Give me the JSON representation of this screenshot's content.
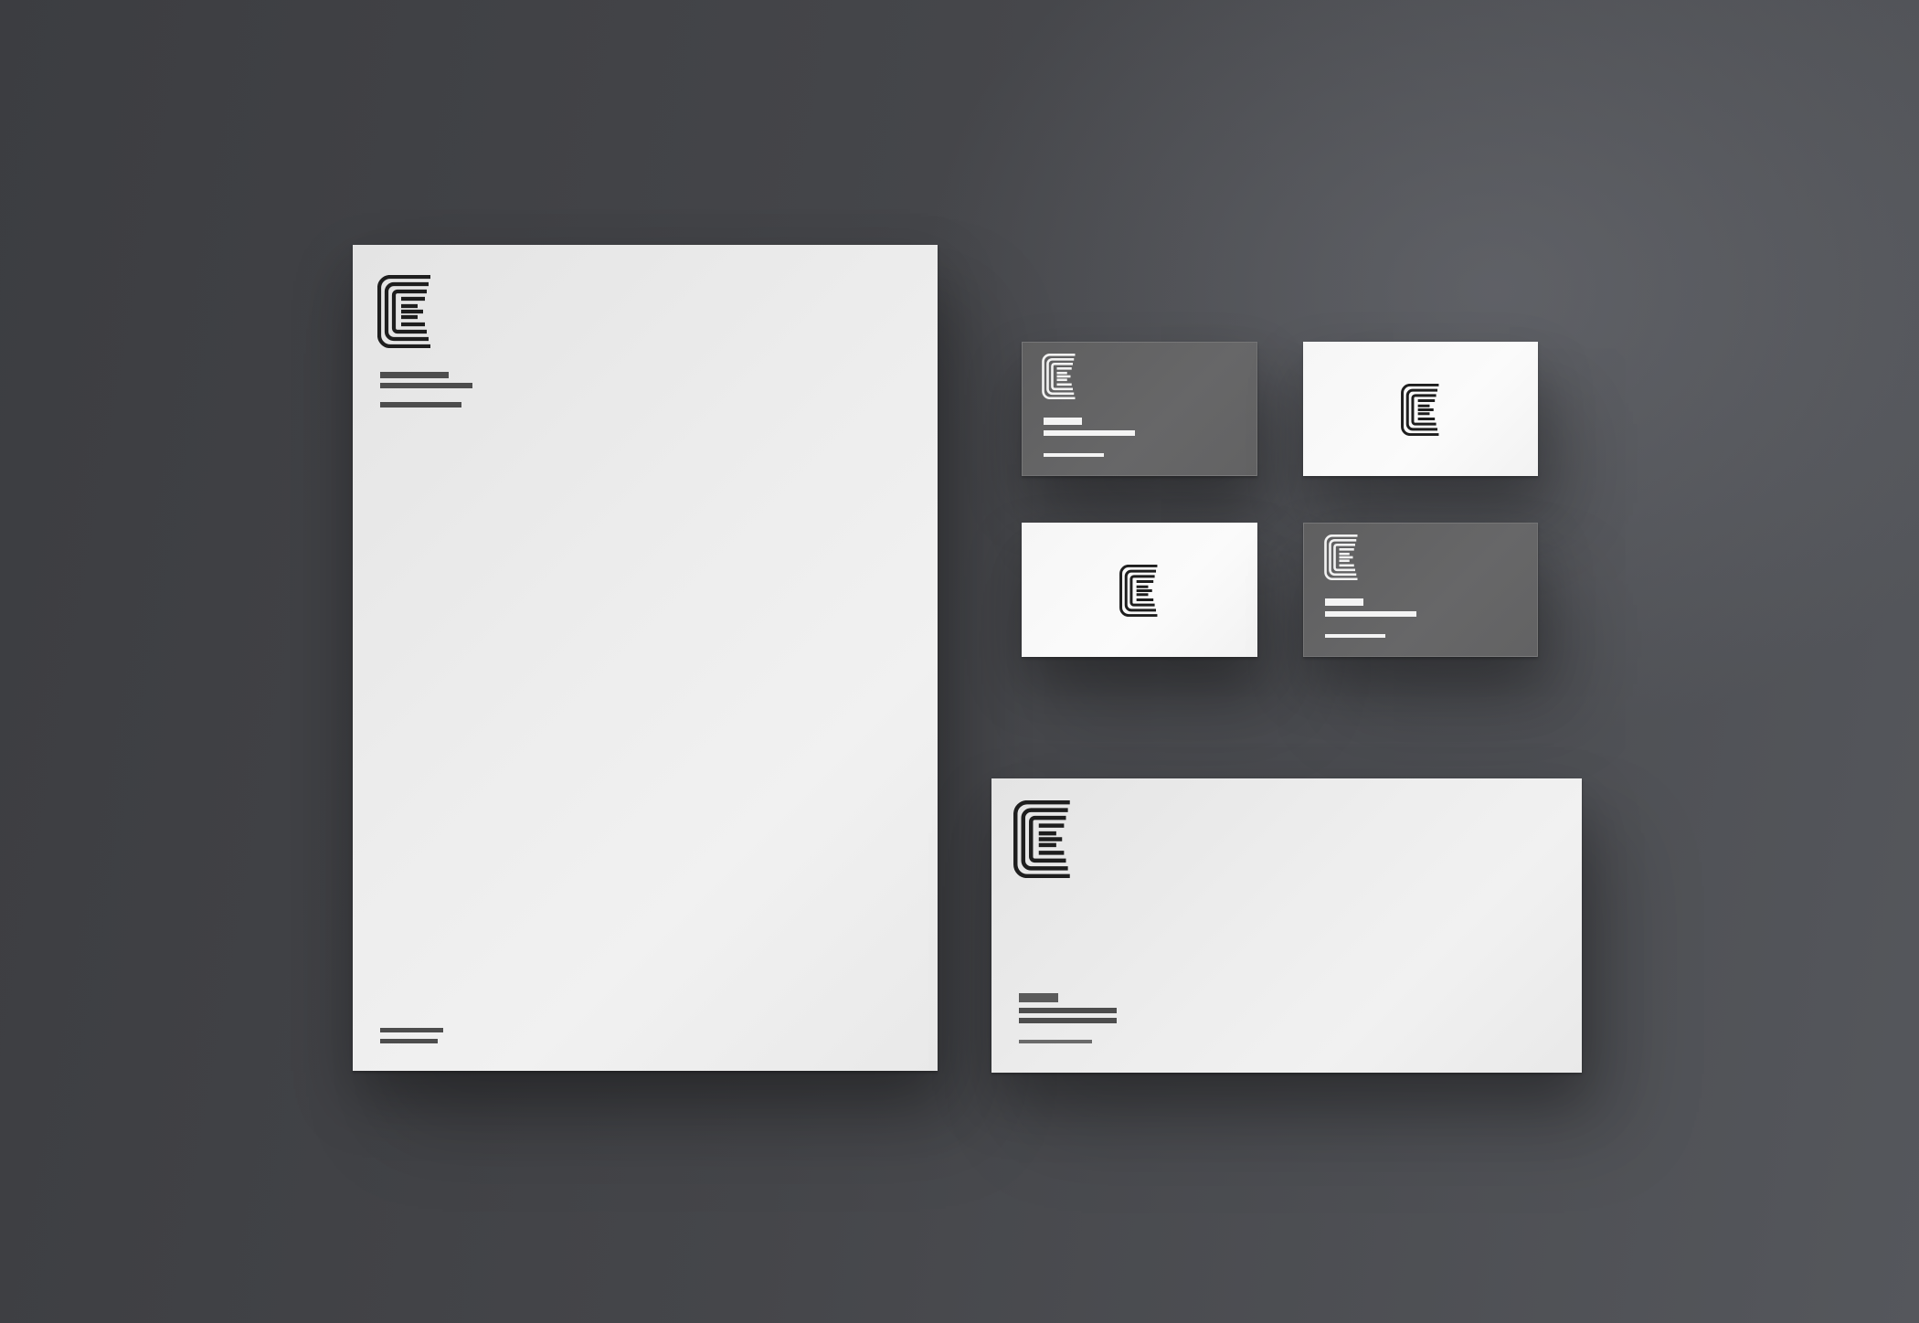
{
  "scene": {
    "description_items": [
      "letterhead",
      "business-card-front-dark",
      "business-card-back-light",
      "business-card-back-light",
      "business-card-front-dark",
      "envelope"
    ]
  },
  "colors": {
    "background": "#45464a",
    "paper": "#ececec",
    "card_dark": "#646465",
    "card_light": "#f8f8f8",
    "ink_dark": "#1e1e1e",
    "ink_light": "#f2f2f2",
    "placeholder_bar": "#4d4d4d"
  },
  "icons": {
    "brand_mark": "stacked-lines-e-logo-icon"
  }
}
